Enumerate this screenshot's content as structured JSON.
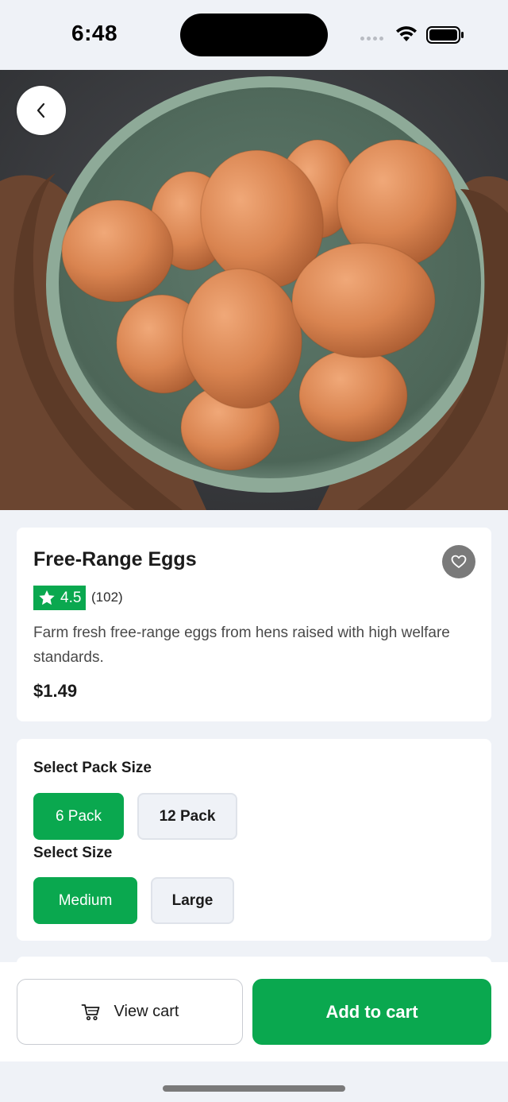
{
  "status_bar": {
    "time": "6:48"
  },
  "product": {
    "title": "Free-Range Eggs",
    "rating": "4.5",
    "rating_count": "(102)",
    "description": "Farm fresh free-range eggs from hens raised with high welfare standards.",
    "price": "$1.49"
  },
  "options": {
    "pack_label": "Select Pack Size",
    "pack_options": [
      "6 Pack",
      "12 Pack"
    ],
    "pack_selected": "6 Pack",
    "size_label": "Select Size",
    "size_options": [
      "Medium",
      "Large"
    ],
    "size_selected": "Medium"
  },
  "actions": {
    "view_cart": "View cart",
    "add_to_cart": "Add to cart"
  },
  "colors": {
    "accent": "#0aa84f",
    "background": "#eff2f7",
    "favorite_bg": "#7a7a7a"
  },
  "icons": [
    "back-chevron-icon",
    "heart-icon",
    "star-icon",
    "cart-icon",
    "wifi-icon",
    "battery-icon"
  ]
}
